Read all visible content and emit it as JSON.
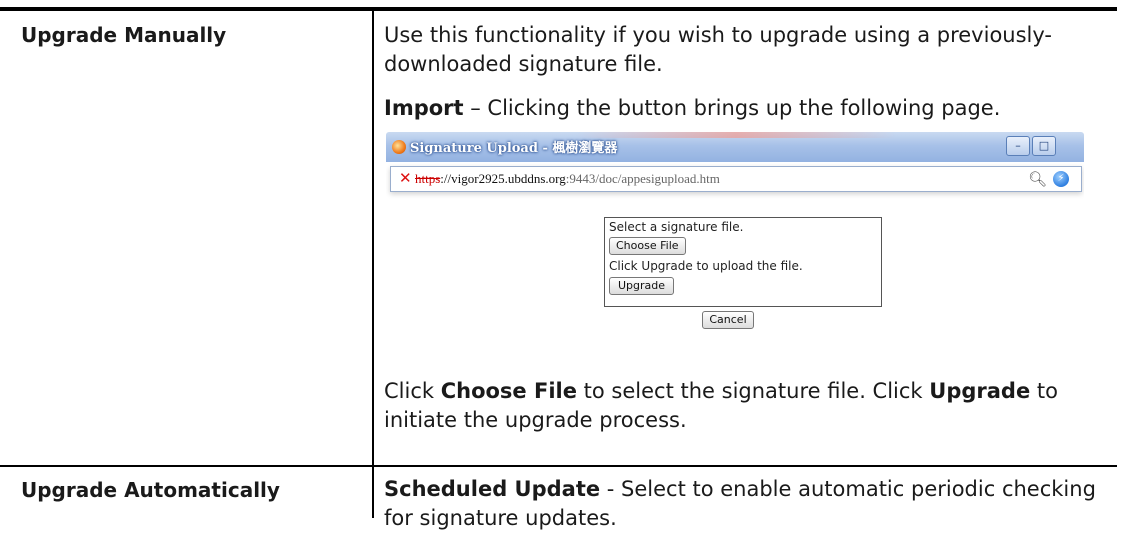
{
  "rows": [
    {
      "label": "Upgrade Manually",
      "desc1": "Use this functionality if you wish to upgrade using a previously-downloaded signature file.",
      "desc2_bold": "Import",
      "desc2_rest": " – Clicking the button brings up the following page.",
      "desc3_pre": "Click ",
      "desc3_bold1": "Choose File",
      "desc3_mid": " to select the signature file. Click ",
      "desc3_bold2": "Upgrade",
      "desc3_post": " to initiate the upgrade process."
    },
    {
      "label": "Upgrade Automatically",
      "desc_bold": "Scheduled Update",
      "desc_rest": " - Select to enable automatic periodic checking for signature updates."
    }
  ],
  "popup": {
    "window_title": "Signature Upload - 楓樹瀏覽器",
    "url_scheme": "https",
    "url_host": "://vigor2925.ubddns.org",
    "url_rest": ":9443/doc/appesigupload.htm",
    "select_text": "Select a signature file.",
    "choose_file_label": "Choose File",
    "upgrade_hint": "Click Upgrade to upload the file.",
    "upgrade_label": "Upgrade",
    "cancel_label": "Cancel",
    "minimize_glyph": "–",
    "maximize_glyph": "□"
  },
  "icons": {
    "app": "browser-app-icon",
    "cert_error": "certificate-error-icon",
    "search": "search-icon",
    "lightning": "lightning-icon"
  }
}
